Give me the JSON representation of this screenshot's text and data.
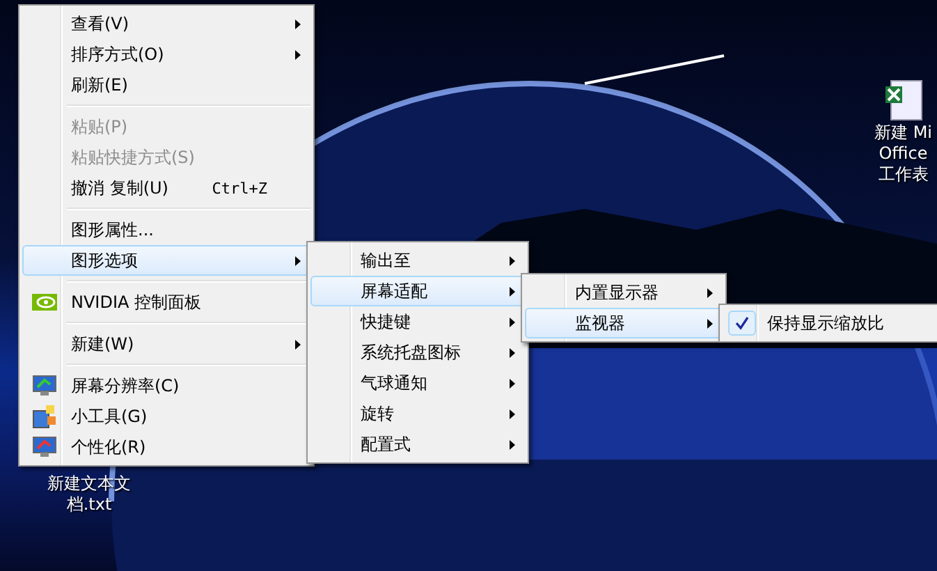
{
  "menus": [
    {
      "items": [
        {
          "kind": "item",
          "label": "查看(V)",
          "submenu": true,
          "disabled": false,
          "selected": false
        },
        {
          "kind": "item",
          "label": "排序方式(O)",
          "submenu": true,
          "disabled": false,
          "selected": false
        },
        {
          "kind": "item",
          "label": "刷新(E)",
          "submenu": false,
          "disabled": false,
          "selected": false
        },
        {
          "kind": "separator"
        },
        {
          "kind": "item",
          "label": "粘贴(P)",
          "submenu": false,
          "disabled": true,
          "selected": false
        },
        {
          "kind": "item",
          "label": "粘贴快捷方式(S)",
          "submenu": false,
          "disabled": true,
          "selected": false
        },
        {
          "kind": "item",
          "label": "撤消 复制(U)",
          "shortcut": "Ctrl+Z",
          "submenu": false,
          "disabled": false,
          "selected": false
        },
        {
          "kind": "separator"
        },
        {
          "kind": "item",
          "label": "图形属性...",
          "submenu": false,
          "disabled": false,
          "selected": false
        },
        {
          "kind": "item",
          "label": "图形选项",
          "submenu": true,
          "disabled": false,
          "selected": true
        },
        {
          "kind": "separator"
        },
        {
          "kind": "item",
          "label": "NVIDIA 控制面板",
          "submenu": false,
          "disabled": false,
          "selected": false
        },
        {
          "kind": "separator"
        },
        {
          "kind": "item",
          "label": "新建(W)",
          "submenu": true,
          "disabled": false,
          "selected": false
        },
        {
          "kind": "separator"
        },
        {
          "kind": "item",
          "label": "屏幕分辨率(C)",
          "submenu": false,
          "disabled": false,
          "selected": false
        },
        {
          "kind": "item",
          "label": "小工具(G)",
          "submenu": false,
          "disabled": false,
          "selected": false
        },
        {
          "kind": "item",
          "label": "个性化(R)",
          "submenu": false,
          "disabled": false,
          "selected": false
        }
      ]
    },
    {
      "items": [
        {
          "kind": "item",
          "label": "输出至",
          "submenu": true,
          "disabled": false,
          "selected": false
        },
        {
          "kind": "item",
          "label": "屏幕适配",
          "submenu": true,
          "disabled": false,
          "selected": true
        },
        {
          "kind": "item",
          "label": "快捷键",
          "submenu": true,
          "disabled": false,
          "selected": false
        },
        {
          "kind": "item",
          "label": "系统托盘图标",
          "submenu": true,
          "disabled": false,
          "selected": false
        },
        {
          "kind": "item",
          "label": "气球通知",
          "submenu": true,
          "disabled": false,
          "selected": false
        },
        {
          "kind": "item",
          "label": "旋转",
          "submenu": true,
          "disabled": false,
          "selected": false
        },
        {
          "kind": "item",
          "label": "配置式",
          "submenu": true,
          "disabled": false,
          "selected": false
        }
      ]
    },
    {
      "items": [
        {
          "kind": "item",
          "label": "内置显示器",
          "submenu": true,
          "disabled": false,
          "selected": false
        },
        {
          "kind": "item",
          "label": "监视器",
          "submenu": true,
          "disabled": false,
          "selected": true
        }
      ]
    },
    {
      "items": [
        {
          "kind": "check",
          "label": "保持显示缩放比",
          "checked": true,
          "submenu": false,
          "disabled": false,
          "selected": false
        }
      ]
    }
  ],
  "desktop_icons": [
    {
      "kind": "text",
      "lines": [
        "新建文本文",
        "档.txt"
      ]
    },
    {
      "kind": "sheet",
      "lines": [
        "新建 Mi",
        "Office",
        "工作表"
      ]
    }
  ]
}
